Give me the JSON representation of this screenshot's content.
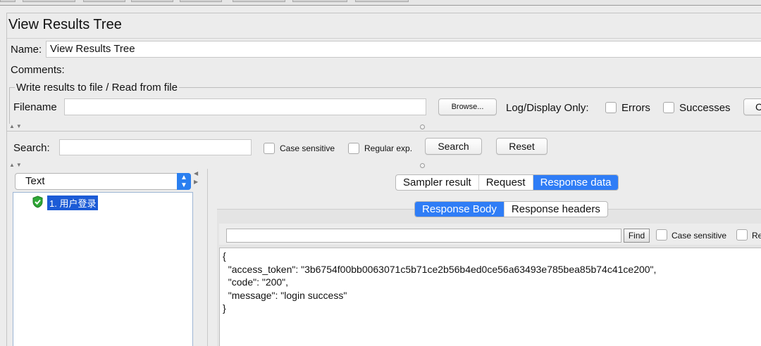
{
  "title": "View Results Tree",
  "name_label": "Name:",
  "name_value": "View Results Tree",
  "comments_label": "Comments:",
  "file_group": {
    "title": "Write results to file / Read from file",
    "filename_label": "Filename",
    "filename_value": "",
    "browse_label": "Browse...",
    "log_display_label": "Log/Display Only:",
    "errors_label": "Errors",
    "successes_label": "Successes",
    "configure_label": "C"
  },
  "search": {
    "label": "Search:",
    "value": "",
    "case_sensitive_label": "Case sensitive",
    "regular_exp_label": "Regular exp.",
    "search_button": "Search",
    "reset_button": "Reset"
  },
  "renderer": {
    "selected": "Text"
  },
  "tree": {
    "items": [
      {
        "label": "1. 用户登录",
        "status": "success"
      }
    ]
  },
  "result_tabs": {
    "items": [
      "Sampler result",
      "Request",
      "Response data"
    ],
    "active": "Response data"
  },
  "response_tabs": {
    "items": [
      "Response Body",
      "Response headers"
    ],
    "active": "Response Body"
  },
  "find": {
    "value": "",
    "button": "Find",
    "case_sensitive_label": "Case sensitive",
    "regular_exp_label": "Re"
  },
  "response_body": "{\n  \"access_token\": \"3b6754f00bb0063071c5b71ce2b56b4ed0ce56a63493e785bea85b74c41ce200\",\n  \"code\": \"200\",\n  \"message\": \"login success\"\n}",
  "colors": {
    "accent": "#2f7df6",
    "selection": "#1c5bd6",
    "success_icon": "#2ea836"
  }
}
